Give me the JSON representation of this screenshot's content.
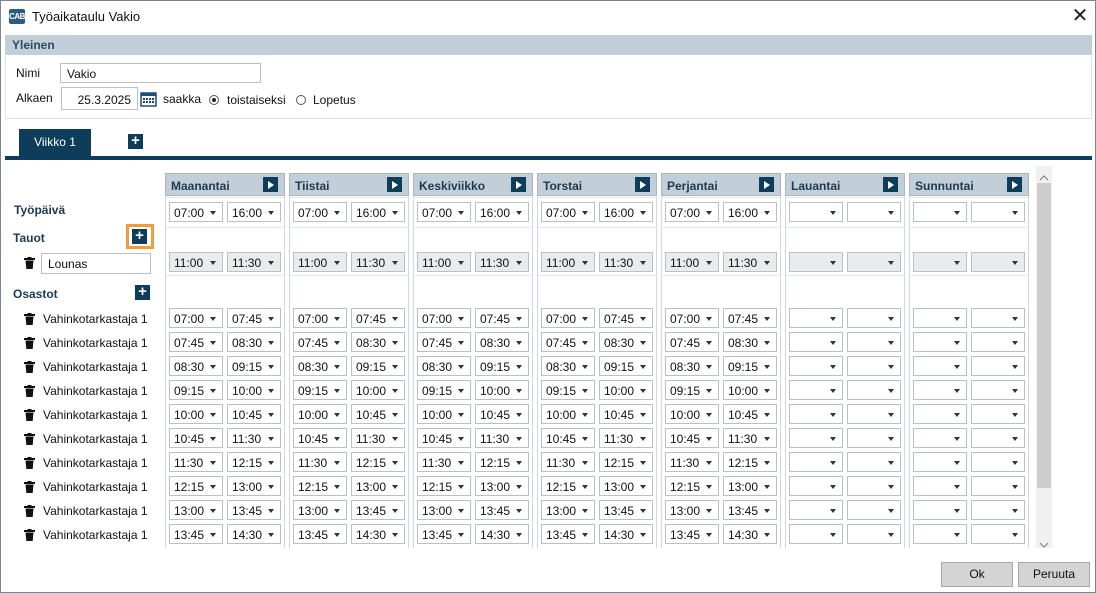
{
  "window": {
    "title": "Työaikataulu Vakio",
    "app_icon": "CAB",
    "close_glyph": "✕"
  },
  "general": {
    "section_title": "Yleinen",
    "name_label": "Nimi",
    "name_value": "Vakio",
    "start_label": "Alkaen",
    "start_value": "25.3.2025",
    "until_label": "saakka",
    "option_until_further": "toistaiseksi",
    "option_end": "Lopetus",
    "selected_option": "toistaiseksi"
  },
  "tabs": [
    {
      "label": "Viikko 1",
      "active": true
    }
  ],
  "labels": {
    "workday": "Työpäivä",
    "breaks": "Tauot",
    "departments": "Osastot"
  },
  "breaks": [
    {
      "name": "Lounas"
    }
  ],
  "days": [
    {
      "name": "Maanantai",
      "workday": [
        "07:00",
        "16:00"
      ],
      "break": [
        "11:00",
        "11:30"
      ]
    },
    {
      "name": "Tiistai",
      "workday": [
        "07:00",
        "16:00"
      ],
      "break": [
        "11:00",
        "11:30"
      ]
    },
    {
      "name": "Keskiviikko",
      "workday": [
        "07:00",
        "16:00"
      ],
      "break": [
        "11:00",
        "11:30"
      ]
    },
    {
      "name": "Torstai",
      "workday": [
        "07:00",
        "16:00"
      ],
      "break": [
        "11:00",
        "11:30"
      ]
    },
    {
      "name": "Perjantai",
      "workday": [
        "07:00",
        "16:00"
      ],
      "break": [
        "11:00",
        "11:30"
      ]
    },
    {
      "name": "Lauantai",
      "workday": [
        "",
        ""
      ],
      "break": [
        "",
        ""
      ]
    },
    {
      "name": "Sunnuntai",
      "workday": [
        "",
        ""
      ],
      "break": [
        "",
        ""
      ]
    }
  ],
  "departments": [
    {
      "name": "Vahinkotarkastaja 1",
      "start": "07:00",
      "end": "07:45"
    },
    {
      "name": "Vahinkotarkastaja 1",
      "start": "07:45",
      "end": "08:30"
    },
    {
      "name": "Vahinkotarkastaja 1",
      "start": "08:30",
      "end": "09:15"
    },
    {
      "name": "Vahinkotarkastaja 1",
      "start": "09:15",
      "end": "10:00"
    },
    {
      "name": "Vahinkotarkastaja 1",
      "start": "10:00",
      "end": "10:45"
    },
    {
      "name": "Vahinkotarkastaja 1",
      "start": "10:45",
      "end": "11:30"
    },
    {
      "name": "Vahinkotarkastaja 1",
      "start": "11:30",
      "end": "12:15"
    },
    {
      "name": "Vahinkotarkastaja 1",
      "start": "12:15",
      "end": "13:00"
    },
    {
      "name": "Vahinkotarkastaja 1",
      "start": "13:00",
      "end": "13:45"
    },
    {
      "name": "Vahinkotarkastaja 1",
      "start": "13:45",
      "end": "14:30"
    }
  ],
  "weekend_days_empty": [
    "Lauantai",
    "Sunnuntai"
  ],
  "buttons": {
    "ok": "Ok",
    "cancel": "Peruuta"
  }
}
